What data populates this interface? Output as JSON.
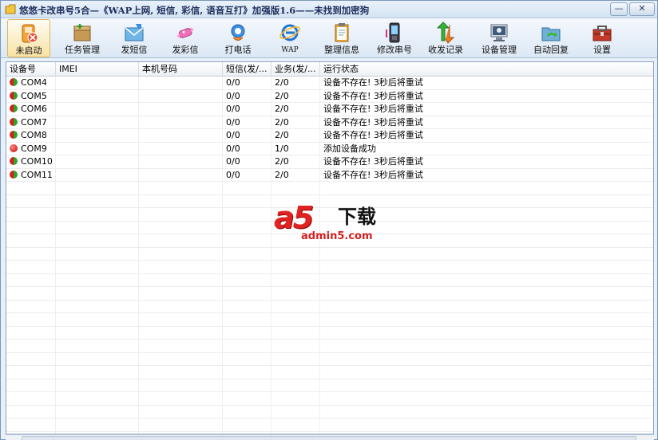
{
  "window": {
    "title": "悠悠卡改串号5合—《WAP上网, 短信, 彩信, 语音互打》加强版1.6——未找到加密狗",
    "minimize_glyph": "—",
    "close_glyph": "✕"
  },
  "toolbar": {
    "items": [
      {
        "label": "未启动",
        "icon": "stopped-phone-icon"
      },
      {
        "label": "任务管理",
        "icon": "task-box-icon"
      },
      {
        "label": "发短信",
        "icon": "sms-envelope-icon"
      },
      {
        "label": "发彩信",
        "icon": "mms-candy-icon"
      },
      {
        "label": "打电话",
        "icon": "phone-call-icon"
      },
      {
        "label": "WAP",
        "icon": "browser-ie-icon"
      },
      {
        "label": "整理信息",
        "icon": "clipboard-icon"
      },
      {
        "label": "修改串号",
        "icon": "mobile-phone-icon"
      },
      {
        "label": "收发记录",
        "icon": "arrows-updown-icon"
      },
      {
        "label": "设备管理",
        "icon": "device-monitor-icon"
      },
      {
        "label": "自动回复",
        "icon": "auto-reply-folder-icon"
      },
      {
        "label": "设置",
        "icon": "settings-toolbox-icon"
      }
    ]
  },
  "table": {
    "columns": [
      "设备号",
      "IMEI",
      "本机号码",
      "短信(发/...",
      "业务(发/...",
      "运行状态"
    ],
    "rows": [
      {
        "port": "COM4",
        "imei": "",
        "number": "",
        "sms": "0/0",
        "biz": "2/0",
        "status": "设备不存在! 3秒后将重试",
        "indicator": "mixed"
      },
      {
        "port": "COM5",
        "imei": "",
        "number": "",
        "sms": "0/0",
        "biz": "2/0",
        "status": "设备不存在! 3秒后将重试",
        "indicator": "mixed"
      },
      {
        "port": "COM6",
        "imei": "",
        "number": "",
        "sms": "0/0",
        "biz": "2/0",
        "status": "设备不存在! 3秒后将重试",
        "indicator": "mixed"
      },
      {
        "port": "COM7",
        "imei": "",
        "number": "",
        "sms": "0/0",
        "biz": "2/0",
        "status": "设备不存在! 3秒后将重试",
        "indicator": "mixed"
      },
      {
        "port": "COM8",
        "imei": "",
        "number": "",
        "sms": "0/0",
        "biz": "2/0",
        "status": "设备不存在! 3秒后将重试",
        "indicator": "mixed"
      },
      {
        "port": "COM9",
        "imei": "",
        "number": "",
        "sms": "0/0",
        "biz": "1/0",
        "status": "添加设备成功",
        "indicator": "red"
      },
      {
        "port": "COM10",
        "imei": "",
        "number": "",
        "sms": "0/0",
        "biz": "2/0",
        "status": "设备不存在! 3秒后将重试",
        "indicator": "mixed"
      },
      {
        "port": "COM11",
        "imei": "",
        "number": "",
        "sms": "0/0",
        "biz": "2/0",
        "status": "设备不存在! 3秒后将重试",
        "indicator": "mixed"
      }
    ]
  },
  "watermark": {
    "brand": "a5",
    "download": "下载",
    "url": "admin5.com"
  },
  "colors": {
    "indicator_red": "#d81d1d",
    "indicator_green": "#2aa52a",
    "watermark_red": "#e02222"
  }
}
